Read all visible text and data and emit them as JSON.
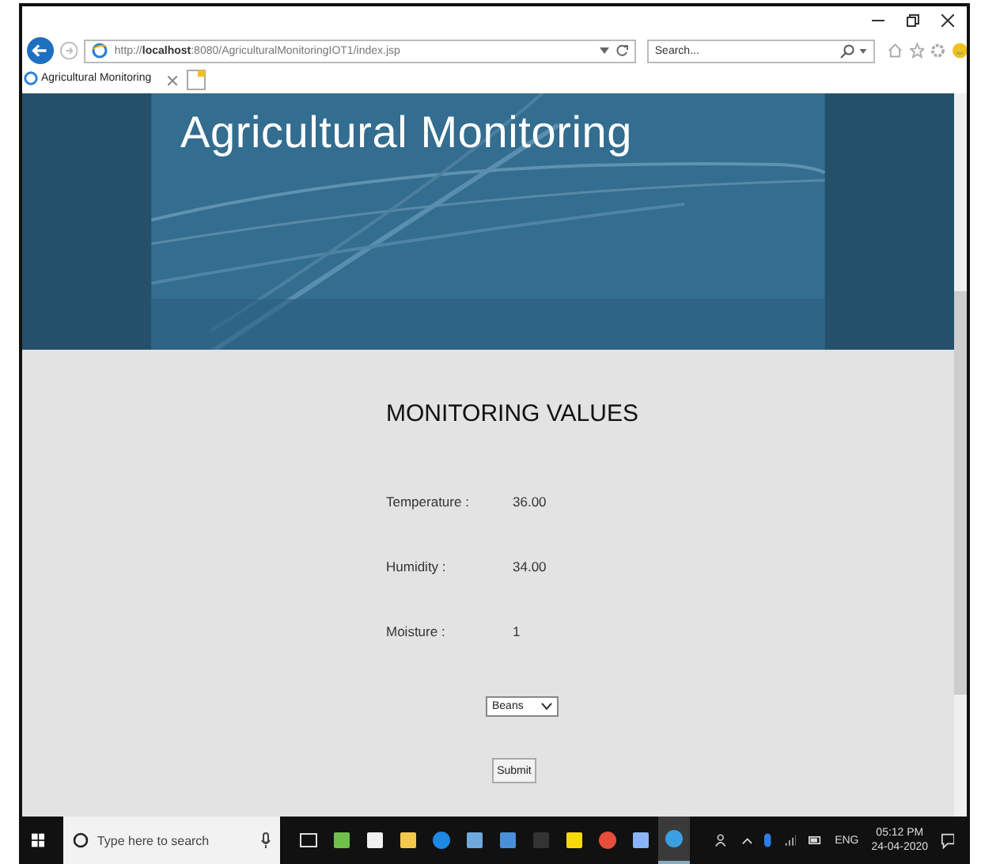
{
  "browser": {
    "address": "http://**localhost**:8080/AgriculturalMonitoringIOT1/index.jsp",
    "search_placeholder": "Search...",
    "tabs": [
      {
        "label": "Agricultural Monitoring",
        "selected": true
      }
    ]
  },
  "page": {
    "title": "Agricultural Monitoring",
    "heading": "MONITORING VALUES",
    "readings": [
      {
        "label": "Temperature :",
        "value": "36.00"
      },
      {
        "label": "Humidity :",
        "value": "34.00"
      },
      {
        "label": "Moisture :",
        "value": "1"
      }
    ],
    "crop_select": {
      "value": "Beans"
    },
    "submit": "Submit"
  },
  "taskbar": {
    "search_placeholder": "Type here to search",
    "language": "ENG",
    "time": "05:12 PM",
    "date": "24-04-2020",
    "apps": [
      {
        "kind": "taskview",
        "selected": false
      },
      {
        "kind": "notes",
        "selected": false
      },
      {
        "kind": "store",
        "selected": false
      },
      {
        "kind": "folder",
        "selected": false
      },
      {
        "kind": "edge",
        "selected": false
      },
      {
        "kind": "paint",
        "selected": false
      },
      {
        "kind": "mail",
        "selected": false
      },
      {
        "kind": "terminal",
        "selected": false
      },
      {
        "kind": "sticky",
        "selected": false
      },
      {
        "kind": "chrome",
        "selected": false
      },
      {
        "kind": "box",
        "selected": false
      },
      {
        "kind": "ie",
        "selected": true
      }
    ]
  }
}
